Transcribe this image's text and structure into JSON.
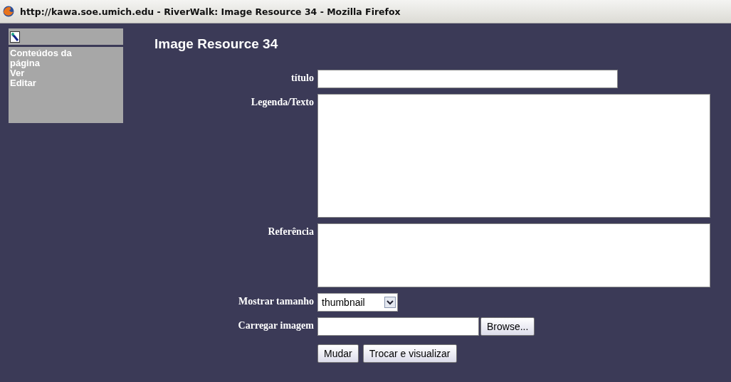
{
  "window": {
    "title": "http://kawa.soe.umich.edu - RiverWalk: Image Resource 34 - Mozilla Firefox"
  },
  "sidebar": {
    "items": [
      {
        "label": "Conteúdos da página"
      },
      {
        "label": "Ver"
      },
      {
        "label": "Editar"
      }
    ]
  },
  "heading": "Image Resource 34",
  "form": {
    "fields": [
      {
        "kind": "text",
        "label": "título"
      },
      {
        "kind": "textarea",
        "label": "Legenda/Texto"
      },
      {
        "kind": "textarea",
        "label": "Referência"
      },
      {
        "kind": "select",
        "label": "Mostrar tamanho",
        "value": "thumbnail"
      },
      {
        "kind": "file",
        "label": "Carregar imagem",
        "button": "Browse..."
      }
    ],
    "buttons": [
      "Mudar",
      "Trocar e visualizar"
    ]
  }
}
